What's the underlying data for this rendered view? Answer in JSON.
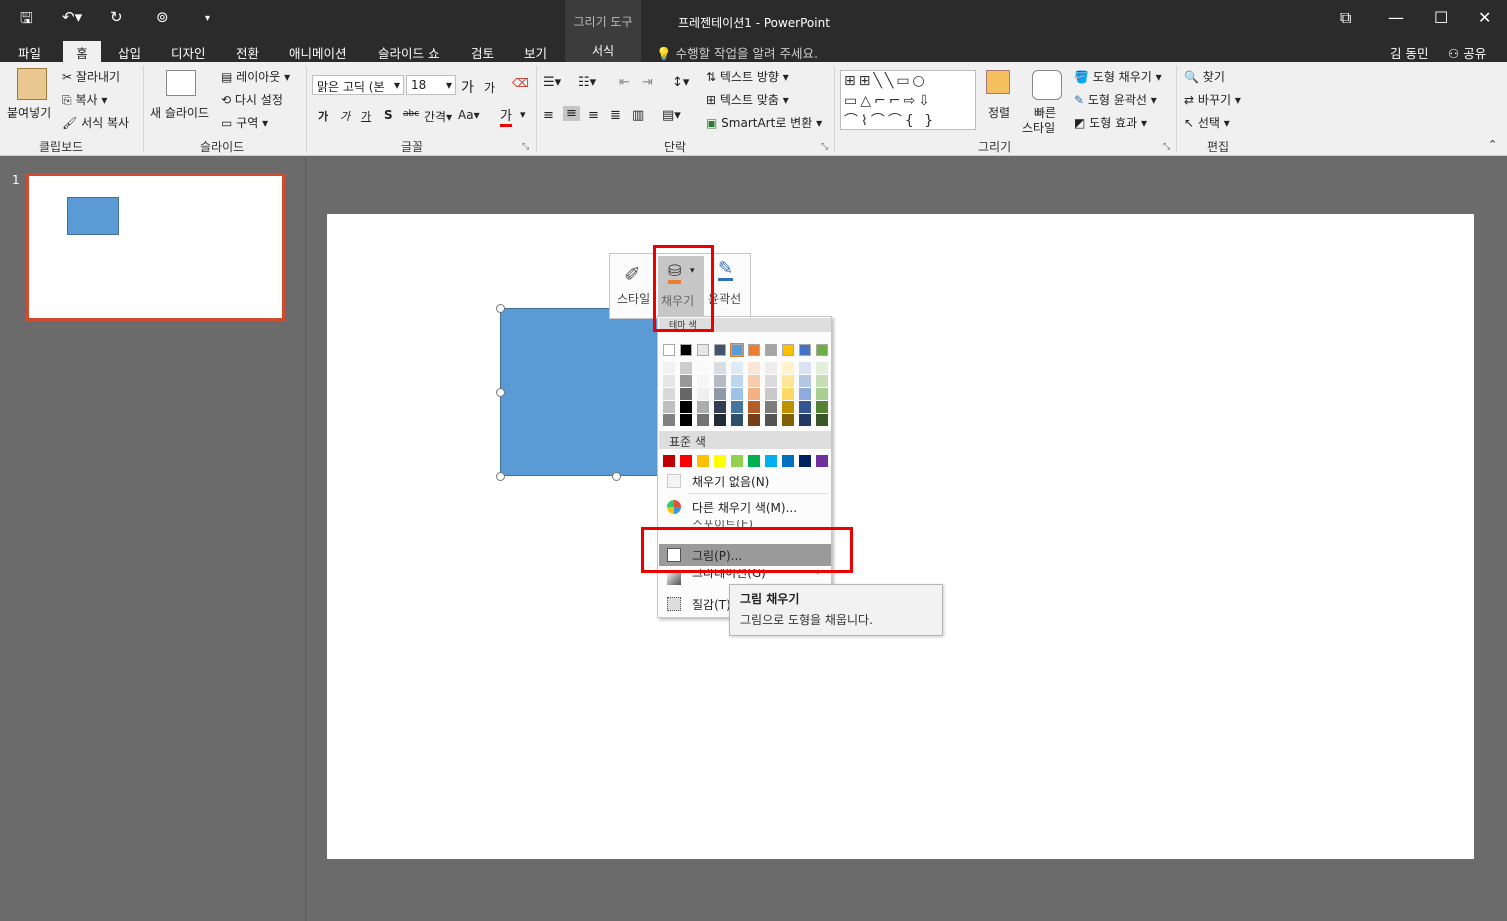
{
  "title_bar": {
    "context_tools": "그리기 도구",
    "document_title": "프레젠테이션1 - PowerPoint"
  },
  "tabs": {
    "items": [
      "파일",
      "홈",
      "삽입",
      "디자인",
      "전환",
      "애니메이션",
      "슬라이드 쇼",
      "검토",
      "보기"
    ],
    "format": "서식",
    "tell_me": "수행할 작업을 알려 주세요.",
    "user": "김 동민",
    "share": "공유"
  },
  "ribbon": {
    "clipboard": {
      "paste": "붙여넣기",
      "cut": "잘라내기",
      "copy": "복사",
      "format_painter": "서식 복사",
      "label": "클립보드"
    },
    "slides": {
      "new_slide": "새 슬라이드",
      "layout": "레이아웃",
      "reset": "다시 설정",
      "section": "구역",
      "label": "슬라이드"
    },
    "font": {
      "name": "맑은 고딕 (본",
      "size": "18",
      "label": "글꼴",
      "grow": "가",
      "shrink": "가",
      "bold": "가",
      "italic": "가",
      "underline": "가",
      "shadow": "S",
      "strike": "abc",
      "spacing": "간격",
      "case": "Aa",
      "color": "가"
    },
    "paragraph": {
      "text_direction": "텍스트 방향",
      "align_text": "텍스트 맞춤",
      "smartart": "SmartArt로 변환",
      "label": "단락"
    },
    "drawing": {
      "arrange": "정렬",
      "quick_styles_1": "빠른",
      "quick_styles_2": "스타일",
      "shape_fill": "도형 채우기",
      "shape_outline": "도형 윤곽선",
      "shape_effects": "도형 효과",
      "label": "그리기"
    },
    "editing": {
      "find": "찾기",
      "replace": "바꾸기",
      "select": "선택",
      "label": "편집"
    }
  },
  "slide_pane": {
    "slide_number": "1"
  },
  "mini_toolbar": {
    "style": "스타일",
    "fill": "채우기",
    "outline": "윤곽선"
  },
  "dropdown": {
    "theme_header": "테마 색",
    "standard_header": "표준 색",
    "no_fill": "채우기 없음(N)",
    "more_colors": "다른 채우기 색(M)...",
    "eyedropper": "스포이트(E)",
    "picture": "그림(P)...",
    "gradient": "그라데이션(G)",
    "texture": "질감(T)",
    "theme_colors": [
      "#ffffff",
      "#000000",
      "#e7e6e6",
      "#44546a",
      "#5b9bd5",
      "#ed7d31",
      "#a5a5a5",
      "#ffc000",
      "#4472c4",
      "#70ad47"
    ],
    "standard_colors": [
      "#c00000",
      "#ff0000",
      "#ffc000",
      "#ffff00",
      "#92d050",
      "#00b050",
      "#00b0f0",
      "#0070c0",
      "#002060",
      "#7030a0"
    ]
  },
  "tooltip": {
    "title": "그림 채우기",
    "description": "그림으로 도형을 채웁니다."
  },
  "colors": {
    "shape_fill": "#5b9bd5",
    "highlight": "#e00000",
    "thumbnail_border": "#d04a2f"
  }
}
